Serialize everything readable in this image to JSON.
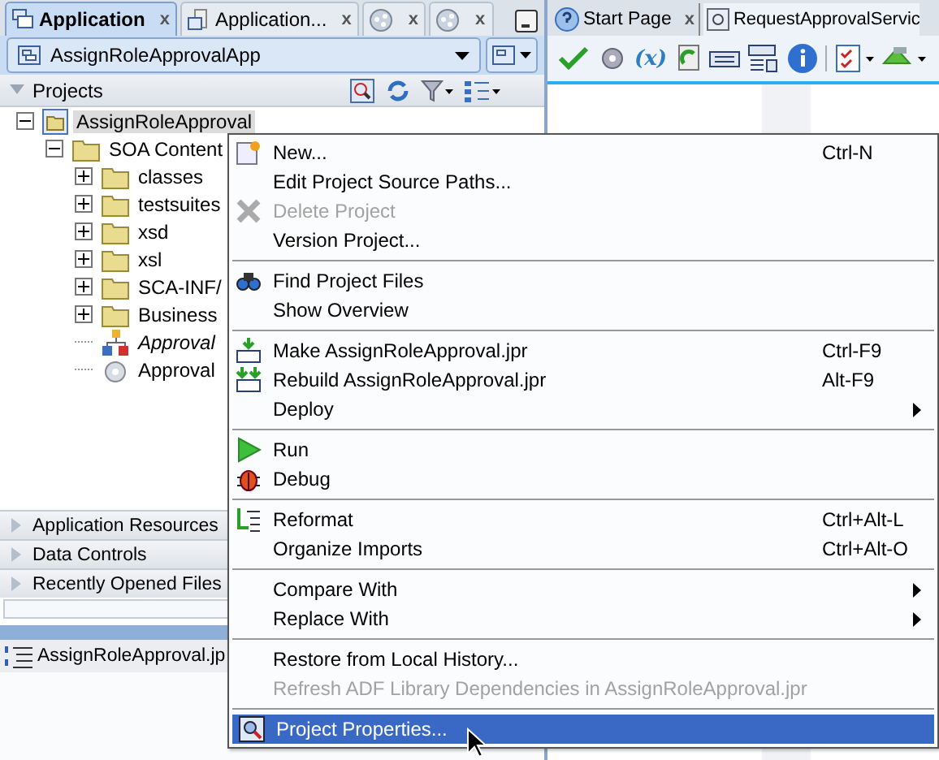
{
  "left_tabs": [
    {
      "label": "Application",
      "close": "x",
      "selected": true,
      "kind": "text"
    },
    {
      "label": "Application...",
      "close": "x",
      "selected": false,
      "kind": "text"
    },
    {
      "close": "x",
      "selected": false,
      "kind": "icon"
    },
    {
      "close": "x",
      "selected": false,
      "kind": "icon"
    }
  ],
  "app_combo": {
    "value": "AssignRoleApprovalApp"
  },
  "projects": {
    "title": "Projects",
    "expanded": true
  },
  "tree": [
    {
      "label": "AssignRoleApproval",
      "kind": "project",
      "expanded": true,
      "selected": true,
      "children": [
        {
          "label": "SOA Content",
          "kind": "folder",
          "expanded": true,
          "selected": false,
          "children": [
            {
              "label": "classes",
              "kind": "folder",
              "expanded": false,
              "selected": false
            },
            {
              "label": "testsuites",
              "kind": "folder",
              "expanded": false,
              "selected": false
            },
            {
              "label": "xsd",
              "kind": "folder",
              "expanded": false,
              "selected": false
            },
            {
              "label": "xsl",
              "kind": "folder",
              "expanded": false,
              "selected": false
            },
            {
              "label": "SCA-INF/",
              "kind": "folder",
              "expanded": false,
              "selected": false
            },
            {
              "label": "Business",
              "kind": "folder",
              "expanded": false,
              "selected": false
            },
            {
              "label": "Approval",
              "kind": "composite",
              "selected": false
            },
            {
              "label": "Approval",
              "kind": "config",
              "selected": false
            }
          ]
        }
      ]
    }
  ],
  "accordion": [
    {
      "label": "Application Resources",
      "expanded": false
    },
    {
      "label": "Data Controls",
      "expanded": false
    },
    {
      "label": "Recently Opened Files",
      "expanded": false
    }
  ],
  "structure": {
    "title": "AssignRoleApproval.jp"
  },
  "right_tabs": [
    {
      "label": "Start Page",
      "close": "x",
      "selected": false
    },
    {
      "label": "RequestApprovalServic",
      "selected": true
    }
  ],
  "toolbar_variable": "(x)",
  "menu": [
    [
      {
        "label": "New...",
        "shortcut": "Ctrl-N",
        "disabled": false
      },
      {
        "label": "Edit Project Source Paths...",
        "disabled": false
      },
      {
        "label": "Delete Project",
        "disabled": true
      },
      {
        "label": "Version Project...",
        "disabled": false
      }
    ],
    [
      {
        "label": "Find Project Files",
        "disabled": false
      },
      {
        "label": "Show Overview",
        "disabled": false
      }
    ],
    [
      {
        "label": "Make AssignRoleApproval.jpr",
        "shortcut": "Ctrl-F9",
        "disabled": false
      },
      {
        "label": "Rebuild AssignRoleApproval.jpr",
        "shortcut": "Alt-F9",
        "disabled": false
      },
      {
        "label": "Deploy",
        "submenu": true,
        "disabled": false
      }
    ],
    [
      {
        "label": "Run",
        "disabled": false
      },
      {
        "label": "Debug",
        "disabled": false
      }
    ],
    [
      {
        "label": "Reformat",
        "shortcut": "Ctrl+Alt-L",
        "disabled": false
      },
      {
        "label": "Organize Imports",
        "shortcut": "Ctrl+Alt-O",
        "disabled": false
      }
    ],
    [
      {
        "label": "Compare With",
        "submenu": true,
        "disabled": false
      },
      {
        "label": "Replace With",
        "submenu": true,
        "disabled": false
      }
    ],
    [
      {
        "label": "Restore from Local History...",
        "disabled": false
      },
      {
        "label": "Refresh ADF Library Dependencies in AssignRoleApproval.jpr",
        "disabled": true
      }
    ],
    [
      {
        "label": "Project Properties...",
        "disabled": false,
        "selected": true
      }
    ]
  ]
}
